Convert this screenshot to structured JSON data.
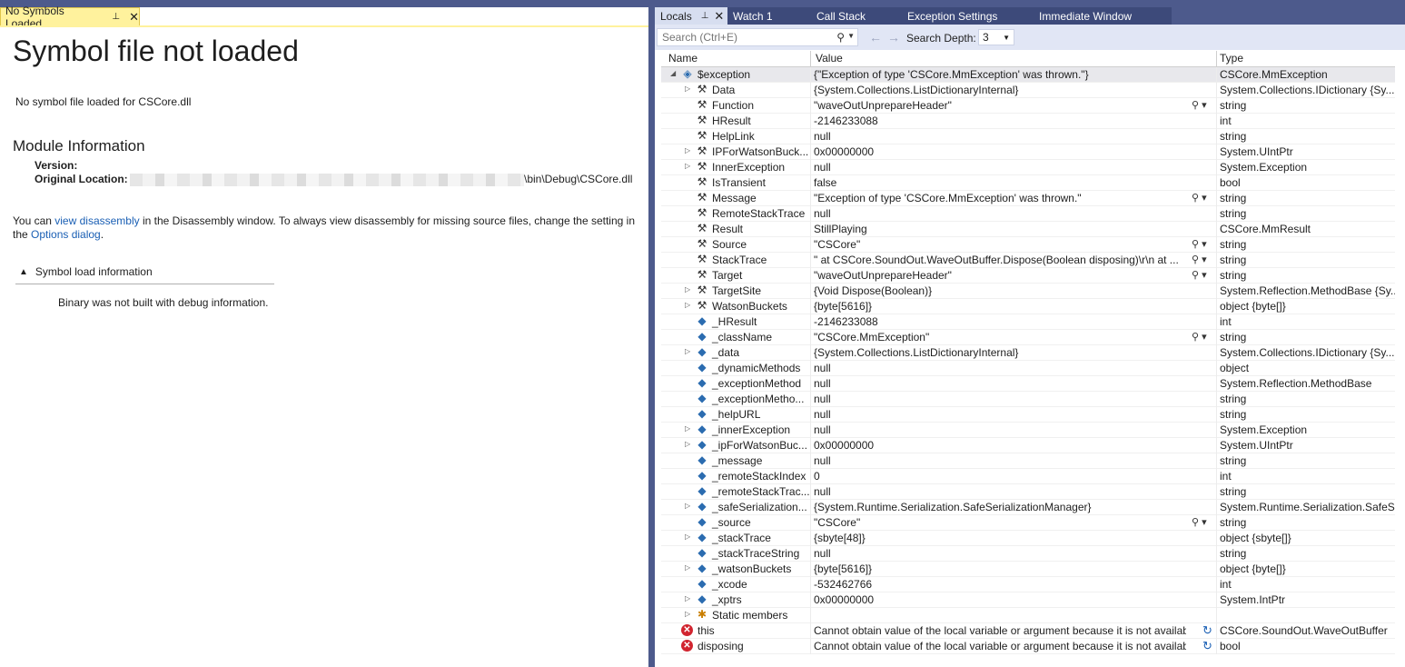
{
  "left": {
    "tab_label": "No Symbols Loaded",
    "tab_pin": "⊥",
    "tab_close": "✕",
    "title": "Symbol file not loaded",
    "subtitle": "No symbol file loaded for CSCore.dll",
    "module_heading": "Module Information",
    "version_label": "Version:",
    "location_label": "Original Location:",
    "location_tail": "\\bin\\Debug\\CSCore.dll",
    "para_pre": "You can ",
    "link_disasm": "view disassembly",
    "para_mid": " in the Disassembly window. To always view disassembly for missing source files, change the setting in the ",
    "link_options": "Options dialog",
    "para_post": ".",
    "symbol_load_label": "Symbol load information",
    "binary_msg": "Binary was not built with debug information."
  },
  "right": {
    "tabs": [
      {
        "label": "Locals",
        "active": true
      },
      {
        "label": "Watch 1"
      },
      {
        "label": "Call Stack"
      },
      {
        "label": "Exception Settings"
      },
      {
        "label": "Immediate Window"
      }
    ],
    "search_placeholder": "Search (Ctrl+E)",
    "depth_label": "Search Depth:",
    "depth_value": "3",
    "columns": {
      "name": "Name",
      "value": "Value",
      "type": "Type"
    },
    "rows": [
      {
        "indent": 0,
        "exp": "open",
        "icon": "obj",
        "name": "$exception",
        "value": "{\"Exception of type 'CSCore.MmException' was thrown.\"}",
        "type": "CSCore.MmException",
        "sel": true
      },
      {
        "indent": 1,
        "exp": "closed",
        "icon": "wrench",
        "name": "Data",
        "value": "{System.Collections.ListDictionaryInternal}",
        "type": "System.Collections.IDictionary {Sy..."
      },
      {
        "indent": 1,
        "exp": "",
        "icon": "wrench",
        "name": "Function",
        "value": "\"waveOutUnprepareHeader\"",
        "type": "string",
        "mag": true
      },
      {
        "indent": 1,
        "exp": "",
        "icon": "wrench",
        "name": "HResult",
        "value": "-2146233088",
        "type": "int"
      },
      {
        "indent": 1,
        "exp": "",
        "icon": "wrench",
        "name": "HelpLink",
        "value": "null",
        "type": "string"
      },
      {
        "indent": 1,
        "exp": "closed",
        "icon": "wrench",
        "name": "IPForWatsonBuck...",
        "value": "0x00000000",
        "type": "System.UIntPtr"
      },
      {
        "indent": 1,
        "exp": "closed",
        "icon": "wrench",
        "name": "InnerException",
        "value": "null",
        "type": "System.Exception"
      },
      {
        "indent": 1,
        "exp": "",
        "icon": "wrench",
        "name": "IsTransient",
        "value": "false",
        "type": "bool"
      },
      {
        "indent": 1,
        "exp": "",
        "icon": "wrench",
        "name": "Message",
        "value": "\"Exception of type 'CSCore.MmException' was thrown.\"",
        "type": "string",
        "mag": true
      },
      {
        "indent": 1,
        "exp": "",
        "icon": "wrench",
        "name": "RemoteStackTrace",
        "value": "null",
        "type": "string"
      },
      {
        "indent": 1,
        "exp": "",
        "icon": "wrench",
        "name": "Result",
        "value": "StillPlaying",
        "type": "CSCore.MmResult"
      },
      {
        "indent": 1,
        "exp": "",
        "icon": "wrench",
        "name": "Source",
        "value": "\"CSCore\"",
        "type": "string",
        "mag": true
      },
      {
        "indent": 1,
        "exp": "",
        "icon": "wrench",
        "name": "StackTrace",
        "value": "\"   at CSCore.SoundOut.WaveOutBuffer.Dispose(Boolean disposing)\\r\\n   at ...",
        "type": "string",
        "mag": true
      },
      {
        "indent": 1,
        "exp": "",
        "icon": "wrench",
        "name": "Target",
        "value": "\"waveOutUnprepareHeader\"",
        "type": "string",
        "mag": true
      },
      {
        "indent": 1,
        "exp": "closed",
        "icon": "wrench",
        "name": "TargetSite",
        "value": "{Void Dispose(Boolean)}",
        "type": "System.Reflection.MethodBase {Sy..."
      },
      {
        "indent": 1,
        "exp": "closed",
        "icon": "wrench",
        "name": "WatsonBuckets",
        "value": "{byte[5616]}",
        "type": "object {byte[]}"
      },
      {
        "indent": 1,
        "exp": "",
        "icon": "field",
        "name": "_HResult",
        "value": "-2146233088",
        "type": "int"
      },
      {
        "indent": 1,
        "exp": "",
        "icon": "field",
        "name": "_className",
        "value": "\"CSCore.MmException\"",
        "type": "string",
        "mag": true
      },
      {
        "indent": 1,
        "exp": "closed",
        "icon": "field",
        "name": "_data",
        "value": "{System.Collections.ListDictionaryInternal}",
        "type": "System.Collections.IDictionary {Sy..."
      },
      {
        "indent": 1,
        "exp": "",
        "icon": "field",
        "name": "_dynamicMethods",
        "value": "null",
        "type": "object"
      },
      {
        "indent": 1,
        "exp": "",
        "icon": "field",
        "name": "_exceptionMethod",
        "value": "null",
        "type": "System.Reflection.MethodBase"
      },
      {
        "indent": 1,
        "exp": "",
        "icon": "field",
        "name": "_exceptionMetho...",
        "value": "null",
        "type": "string"
      },
      {
        "indent": 1,
        "exp": "",
        "icon": "field",
        "name": "_helpURL",
        "value": "null",
        "type": "string"
      },
      {
        "indent": 1,
        "exp": "closed",
        "icon": "field",
        "name": "_innerException",
        "value": "null",
        "type": "System.Exception"
      },
      {
        "indent": 1,
        "exp": "closed",
        "icon": "field",
        "name": "_ipForWatsonBuc...",
        "value": "0x00000000",
        "type": "System.UIntPtr"
      },
      {
        "indent": 1,
        "exp": "",
        "icon": "field",
        "name": "_message",
        "value": "null",
        "type": "string"
      },
      {
        "indent": 1,
        "exp": "",
        "icon": "field",
        "name": "_remoteStackIndex",
        "value": "0",
        "type": "int"
      },
      {
        "indent": 1,
        "exp": "",
        "icon": "field",
        "name": "_remoteStackTrac...",
        "value": "null",
        "type": "string"
      },
      {
        "indent": 1,
        "exp": "closed",
        "icon": "field",
        "name": "_safeSerialization...",
        "value": "{System.Runtime.Serialization.SafeSerializationManager}",
        "type": "System.Runtime.Serialization.SafeS..."
      },
      {
        "indent": 1,
        "exp": "",
        "icon": "field",
        "name": "_source",
        "value": "\"CSCore\"",
        "type": "string",
        "mag": true
      },
      {
        "indent": 1,
        "exp": "closed",
        "icon": "field",
        "name": "_stackTrace",
        "value": "{sbyte[48]}",
        "type": "object {sbyte[]}"
      },
      {
        "indent": 1,
        "exp": "",
        "icon": "field",
        "name": "_stackTraceString",
        "value": "null",
        "type": "string"
      },
      {
        "indent": 1,
        "exp": "closed",
        "icon": "field",
        "name": "_watsonBuckets",
        "value": "{byte[5616]}",
        "type": "object {byte[]}"
      },
      {
        "indent": 1,
        "exp": "",
        "icon": "field",
        "name": "_xcode",
        "value": "-532462766",
        "type": "int"
      },
      {
        "indent": 1,
        "exp": "closed",
        "icon": "field",
        "name": "_xptrs",
        "value": "0x00000000",
        "type": "System.IntPtr"
      },
      {
        "indent": 1,
        "exp": "closed",
        "icon": "static",
        "name": "Static members",
        "value": "",
        "type": ""
      },
      {
        "indent": 0,
        "exp": "",
        "icon": "err",
        "name": "this",
        "value": "Cannot obtain value of the local variable or argument because it is not availabl...",
        "type": "CSCore.SoundOut.WaveOutBuffer",
        "refresh": true
      },
      {
        "indent": 0,
        "exp": "",
        "icon": "err",
        "name": "disposing",
        "value": "Cannot obtain value of the local variable or argument because it is not availabl...",
        "type": "bool",
        "refresh": true
      }
    ]
  }
}
